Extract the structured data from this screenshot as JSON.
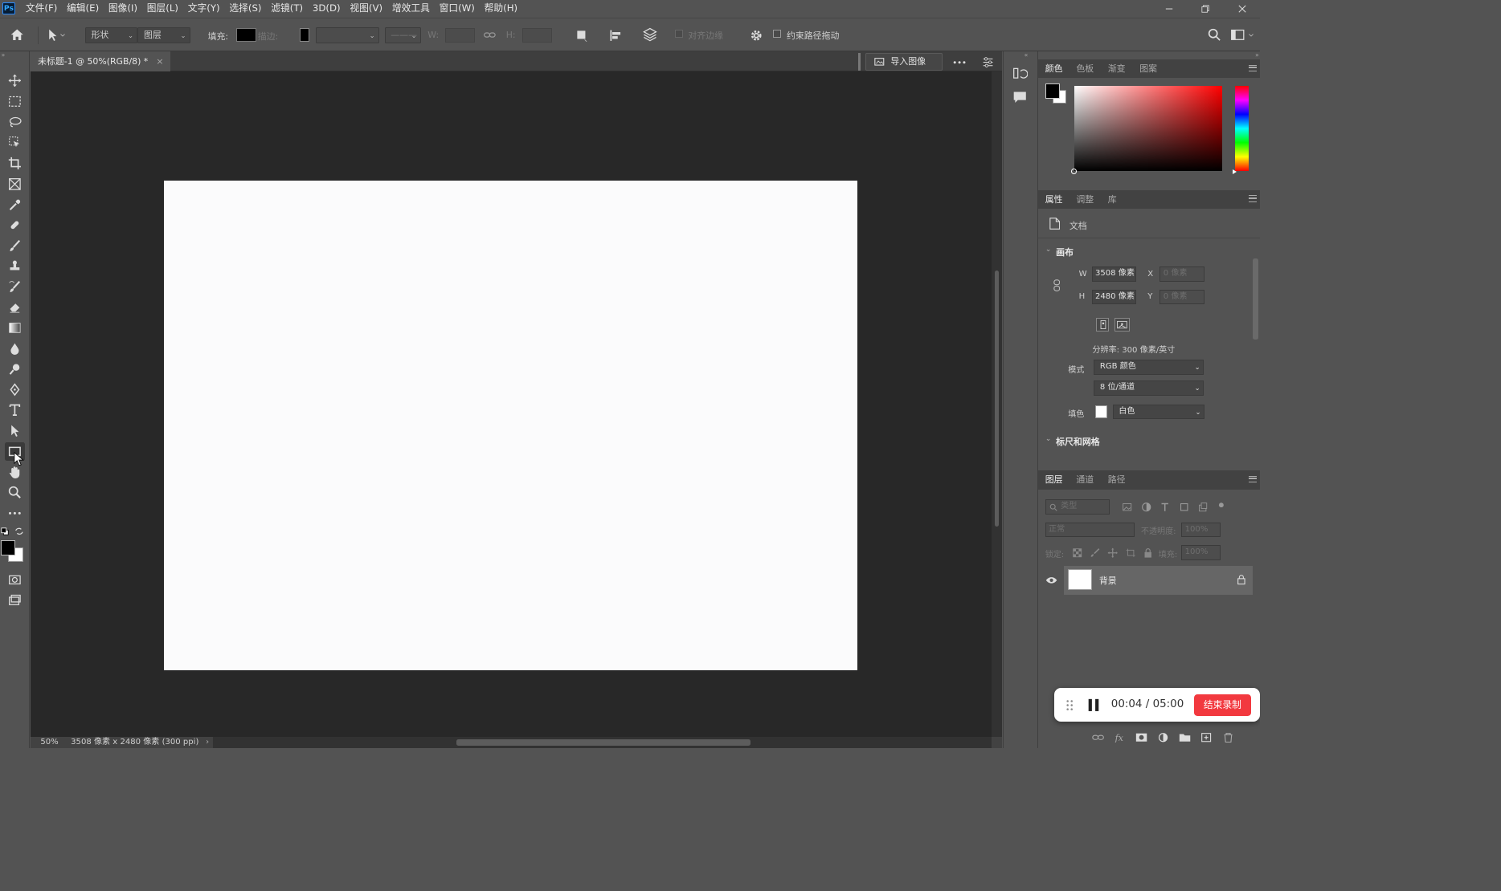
{
  "app": {
    "logo": "Ps"
  },
  "menu": [
    "文件(F)",
    "编辑(E)",
    "图像(I)",
    "图层(L)",
    "文字(Y)",
    "选择(S)",
    "滤镜(T)",
    "3D(D)",
    "视图(V)",
    "增效工具",
    "窗口(W)",
    "帮助(H)"
  ],
  "options": {
    "shape_mode": "形状",
    "layer_mode": "图层",
    "fill_label": "填充:",
    "stroke_label": "描边:",
    "w_label": "W:",
    "h_label": "H:",
    "align_edges": "对齐边缘",
    "constrain_path": "约束路径拖动"
  },
  "document": {
    "tab_title": "未标题-1 @ 50%(RGB/8) *",
    "close": "×",
    "import_button": "导入图像"
  },
  "status": {
    "zoom": "50%",
    "info": "3508 像素 x 2480 像素 (300 ppi)"
  },
  "color_panel": {
    "tabs": [
      "颜色",
      "色板",
      "渐变",
      "图案"
    ]
  },
  "properties": {
    "tabs": [
      "属性",
      "调整",
      "库"
    ],
    "doc_label": "文档",
    "canvas_section": "画布",
    "w_label": "W",
    "w_value": "3508 像素",
    "h_label": "H",
    "h_value": "2480 像素",
    "x_label": "X",
    "x_value": "0 像素",
    "y_label": "Y",
    "y_value": "0 像素",
    "resolution": "分辨率: 300 像素/英寸",
    "mode_label": "模式",
    "mode_value": "RGB 颜色",
    "depth_value": "8 位/通道",
    "fill_label": "填色",
    "fill_value": "白色",
    "rulers_section": "标尺和网格"
  },
  "layers": {
    "tabs": [
      "图层",
      "通道",
      "路径"
    ],
    "filter_placeholder": "类型",
    "blend_mode": "正常",
    "opacity_label": "不透明度:",
    "opacity_value": "100%",
    "lock_label": "锁定:",
    "fill_label": "填充:",
    "fill_value": "100%",
    "items": [
      {
        "name": "背景"
      }
    ]
  },
  "recorder": {
    "time": "00:04",
    "divider": "/",
    "total": "05:00",
    "stop_label": "结束录制"
  },
  "colors": {
    "accent": "#31a8ff",
    "record_red": "#f2393f",
    "canvas_bg": "#282828"
  }
}
